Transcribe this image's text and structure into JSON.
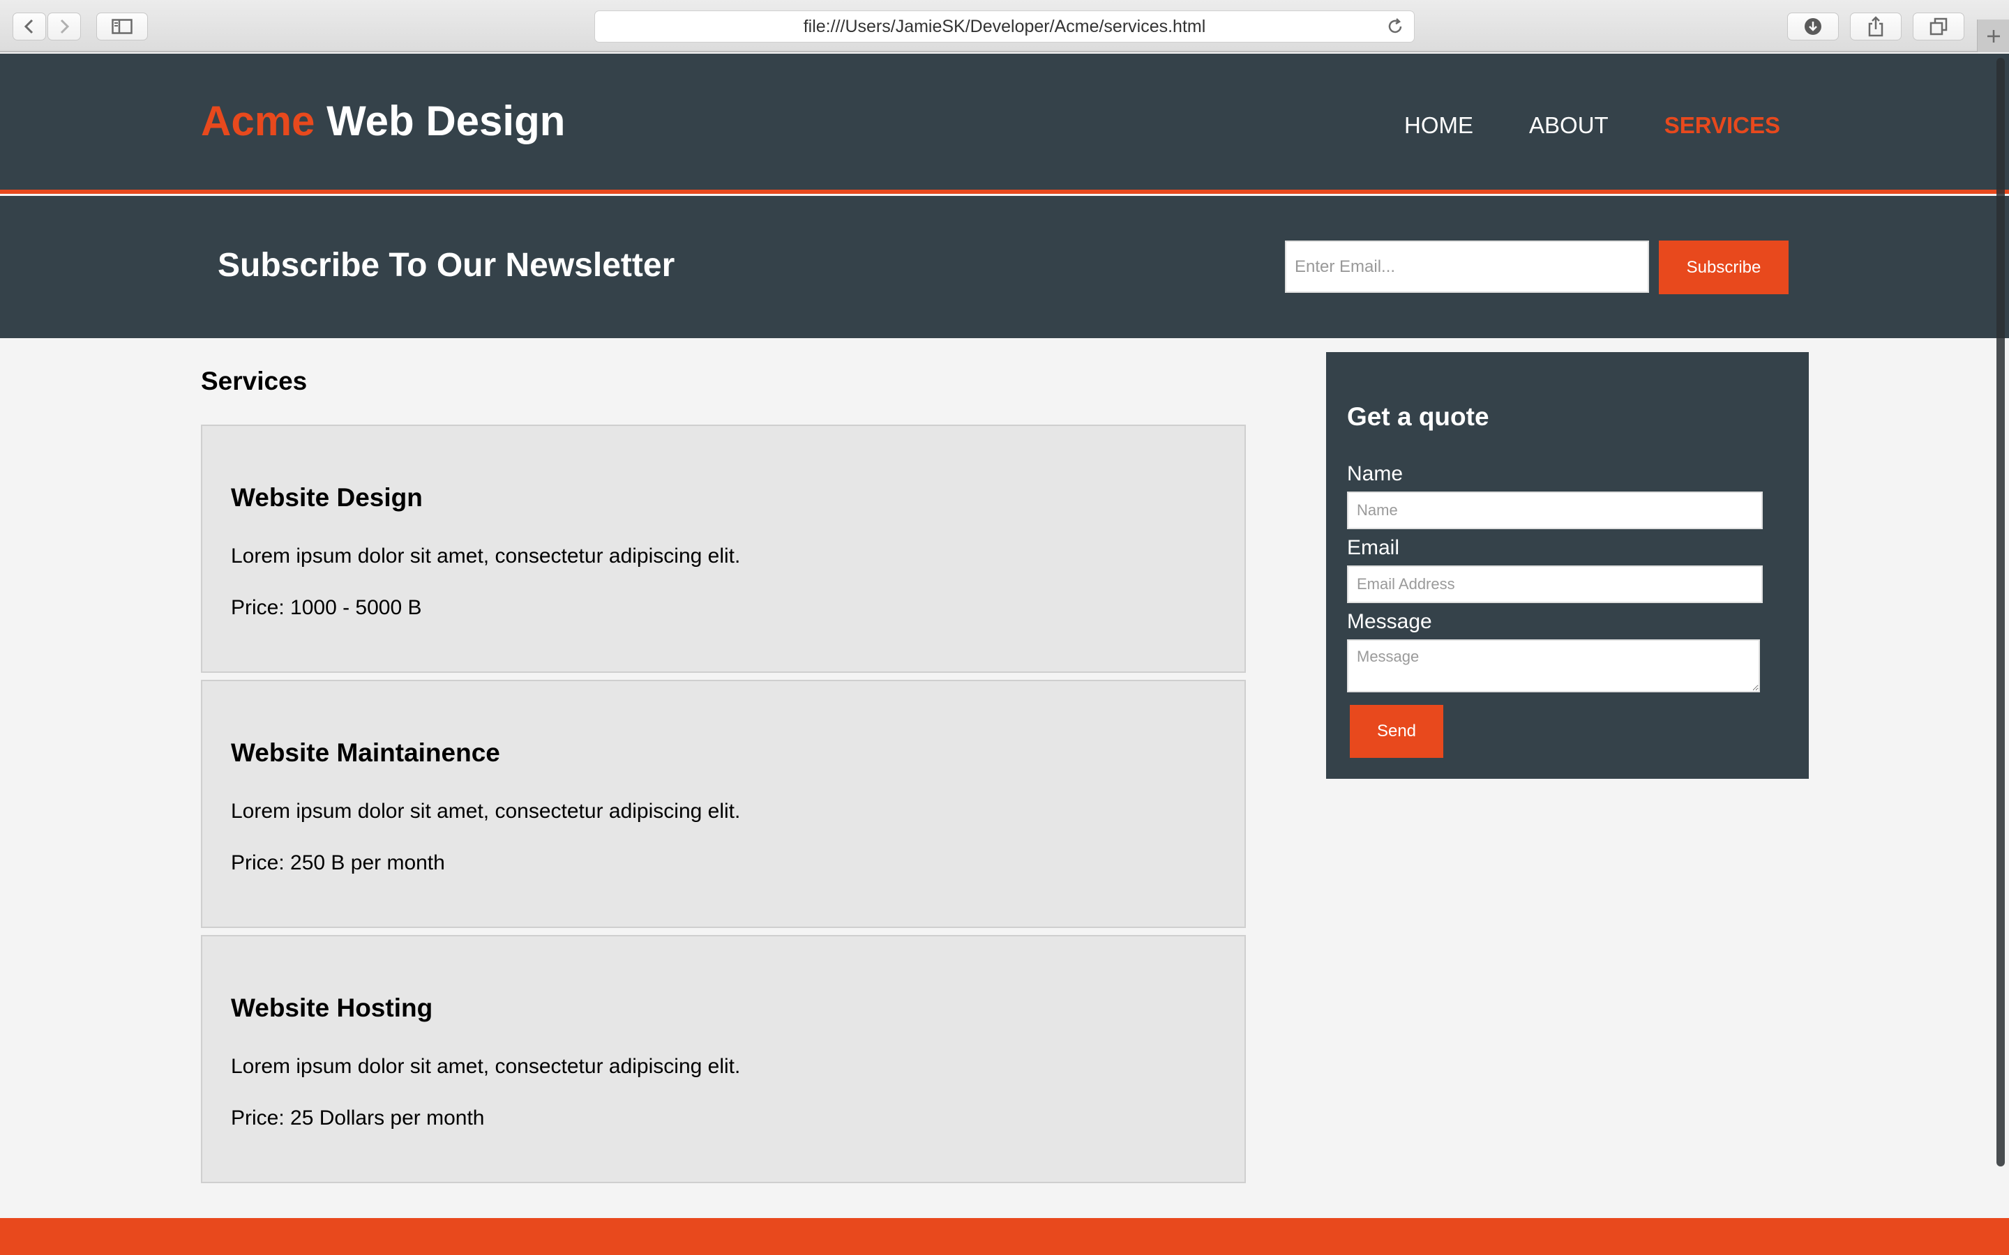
{
  "browser": {
    "url": "file:///Users/JamieSK/Developer/Acme/services.html"
  },
  "header": {
    "brand_highlight": "Acme",
    "brand_rest": "Web Design",
    "nav": [
      {
        "label": "HOME"
      },
      {
        "label": "ABOUT"
      },
      {
        "label": "SERVICES"
      }
    ]
  },
  "newsletter": {
    "title": "Subscribe To Our Newsletter",
    "email_placeholder": "Enter Email...",
    "button": "Subscribe"
  },
  "main": {
    "title": "Services",
    "services": [
      {
        "title": "Website Design",
        "desc": "Lorem ipsum dolor sit amet, consectetur adipiscing elit.",
        "price": "Price: 1000 - 5000 B"
      },
      {
        "title": "Website Maintainence",
        "desc": "Lorem ipsum dolor sit amet, consectetur adipiscing elit.",
        "price": "Price: 250 B per month"
      },
      {
        "title": "Website Hosting",
        "desc": "Lorem ipsum dolor sit amet, consectetur adipiscing elit.",
        "price": "Price: 25 Dollars per month"
      }
    ]
  },
  "quote": {
    "title": "Get a quote",
    "name_label": "Name",
    "name_placeholder": "Name",
    "email_label": "Email",
    "email_placeholder": "Email Address",
    "message_label": "Message",
    "message_placeholder": "Message",
    "button": "Send"
  },
  "colors": {
    "accent": "#e8491d",
    "dark": "#35424a",
    "background": "#f4f4f4"
  },
  "icons": [
    "back-icon",
    "forward-icon",
    "sidebar-icon",
    "reload-icon",
    "download-icon",
    "share-icon",
    "tabs-icon",
    "new-tab-icon"
  ]
}
